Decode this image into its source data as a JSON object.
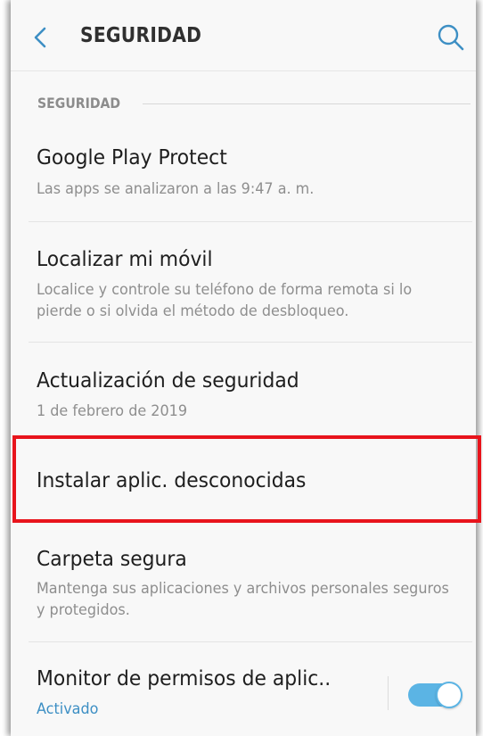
{
  "appbar": {
    "title": "SEGURIDAD",
    "back_icon": "chevron-left-icon",
    "search_icon": "search-icon",
    "accent_color": "#3d8fc4"
  },
  "section": {
    "label": "SEGURIDAD"
  },
  "items": [
    {
      "title": "Google Play Protect",
      "subtitle": "Las apps se analizaron a las 9:47 a. m."
    },
    {
      "title": "Localizar mi móvil",
      "subtitle": "Localice y controle su teléfono de forma remota si lo pierde o si olvida el método de desbloqueo."
    },
    {
      "title": "Actualización de seguridad",
      "subtitle": "1 de febrero de 2019"
    },
    {
      "title": "Instalar aplic. desconocidas",
      "highlighted": true,
      "highlight_color": "#e8141c"
    },
    {
      "title": "Carpeta segura",
      "subtitle": "Mantenga sus aplicaciones y archivos personales seguros y protegidos."
    },
    {
      "title": "Monitor de permisos de aplic..",
      "status": "Activado",
      "status_color": "#3d8fc4",
      "toggle_on": true,
      "toggle_color": "#5bb4e4"
    }
  ]
}
